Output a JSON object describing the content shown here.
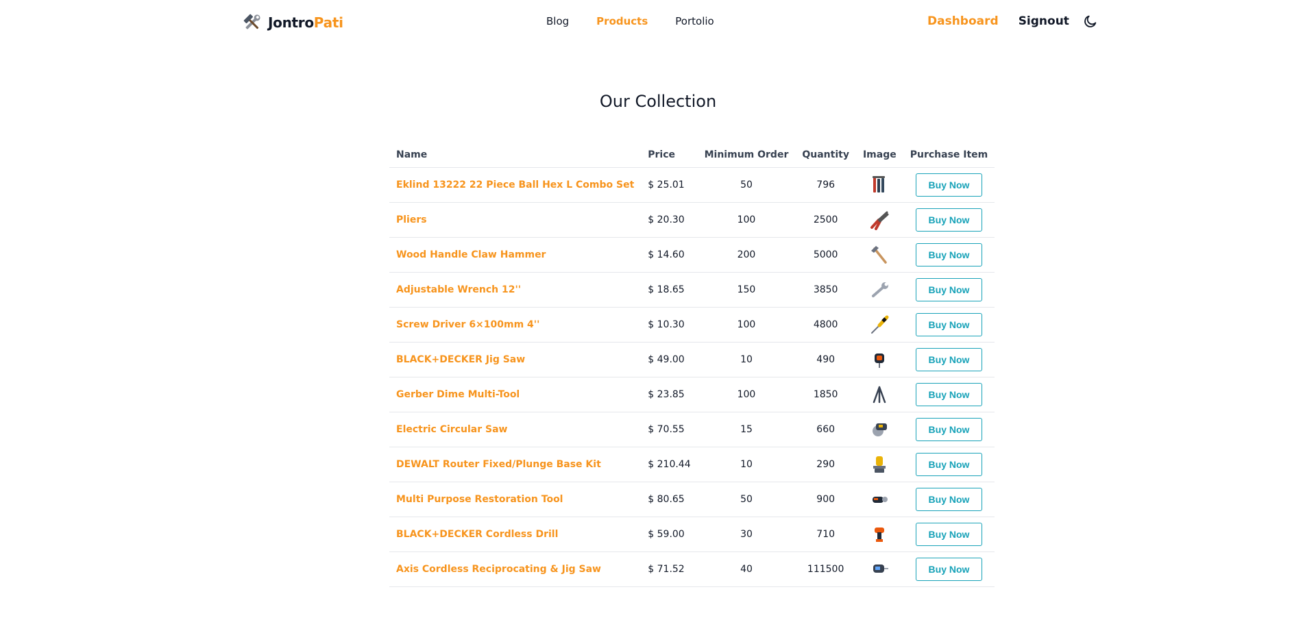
{
  "brand": {
    "part1": "Jontro",
    "part2": "Pati",
    "logo_icon": "hammer-wrench-icon",
    "accent": "#f7941d"
  },
  "nav": {
    "links": [
      {
        "label": "Blog",
        "active": false
      },
      {
        "label": "Products",
        "active": true
      },
      {
        "label": "Portolio",
        "active": false
      }
    ],
    "dashboard": "Dashboard",
    "signout": "Signout",
    "theme_icon": "moon-icon"
  },
  "page": {
    "title": "Our Collection"
  },
  "table": {
    "headers": {
      "name": "Name",
      "price": "Price",
      "min_order": "Minimum Order",
      "quantity": "Quantity",
      "image": "Image",
      "purchase": "Purchase Item"
    },
    "rows": [
      {
        "name": "Eklind 13222 22 Piece Ball Hex L Combo Set",
        "price": "$ 25.01",
        "min_order": "50",
        "quantity": "796",
        "image": "hex-key-set-icon",
        "button": "Buy Now"
      },
      {
        "name": "Pliers",
        "price": "$ 20.30",
        "min_order": "100",
        "quantity": "2500",
        "image": "pliers-icon",
        "button": "Buy Now"
      },
      {
        "name": "Wood Handle Claw Hammer",
        "price": "$ 14.60",
        "min_order": "200",
        "quantity": "5000",
        "image": "claw-hammer-icon",
        "button": "Buy Now"
      },
      {
        "name": "Adjustable Wrench 12''",
        "price": "$ 18.65",
        "min_order": "150",
        "quantity": "3850",
        "image": "adjustable-wrench-icon",
        "button": "Buy Now"
      },
      {
        "name": "Screw Driver 6×100mm 4''",
        "price": "$ 10.30",
        "min_order": "100",
        "quantity": "4800",
        "image": "screwdriver-icon",
        "button": "Buy Now"
      },
      {
        "name": "BLACK+DECKER Jig Saw",
        "price": "$ 49.00",
        "min_order": "10",
        "quantity": "490",
        "image": "jig-saw-icon",
        "button": "Buy Now"
      },
      {
        "name": "Gerber Dime Multi-Tool",
        "price": "$ 23.85",
        "min_order": "100",
        "quantity": "1850",
        "image": "multi-tool-icon",
        "button": "Buy Now"
      },
      {
        "name": "Electric Circular Saw",
        "price": "$ 70.55",
        "min_order": "15",
        "quantity": "660",
        "image": "circular-saw-icon",
        "button": "Buy Now"
      },
      {
        "name": "DEWALT Router Fixed/Plunge Base Kit",
        "price": "$ 210.44",
        "min_order": "10",
        "quantity": "290",
        "image": "router-icon",
        "button": "Buy Now"
      },
      {
        "name": "Multi Purpose Restoration Tool",
        "price": "$ 80.65",
        "min_order": "50",
        "quantity": "900",
        "image": "restoration-tool-icon",
        "button": "Buy Now"
      },
      {
        "name": "BLACK+DECKER Cordless Drill",
        "price": "$ 59.00",
        "min_order": "30",
        "quantity": "710",
        "image": "cordless-drill-icon",
        "button": "Buy Now"
      },
      {
        "name": "Axis Cordless Reciprocating & Jig Saw",
        "price": "$ 71.52",
        "min_order": "40",
        "quantity": "111500",
        "image": "reciprocating-saw-icon",
        "button": "Buy Now"
      }
    ]
  },
  "colors": {
    "accent": "#f7941d",
    "button": "#17a2b8",
    "text": "#111827",
    "border": "#e5e7eb"
  }
}
